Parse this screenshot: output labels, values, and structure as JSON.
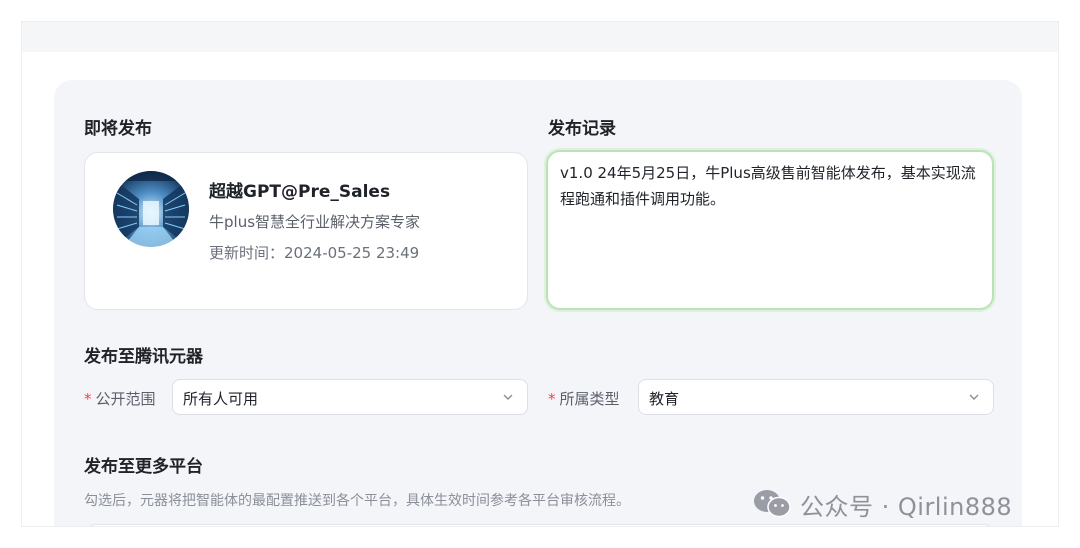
{
  "publish": {
    "section_title": "即将发布",
    "agent": {
      "name": "超越GPT@Pre_Sales",
      "description": "牛plus智慧全行业解决方案专家",
      "updated_label": "更新时间：",
      "updated_value": "2024-05-25 23:49"
    }
  },
  "release_record": {
    "section_title": "发布记录",
    "notes": "v1.0 24年5月25日，牛Plus高级售前智能体发布，基本实现流程跑通和插件调用功能。"
  },
  "tencent": {
    "section_title": "发布至腾讯元器",
    "visibility": {
      "required_mark": "*",
      "label": "公开范围",
      "value": "所有人可用"
    },
    "category": {
      "required_mark": "*",
      "label": "所属类型",
      "value": "教育"
    }
  },
  "more_platforms": {
    "section_title": "发布至更多平台",
    "hint": "勾选后，元器将把智能体的最配置推送到各个平台，具体生效时间参考各平台审核流程。"
  },
  "watermark": {
    "text": "公众号 · Qirlin888",
    "icon": "wechat-icon"
  },
  "colors": {
    "panel_bg": "#f4f5f9",
    "focus_border": "#b9e5b5",
    "required": "#e5484d"
  }
}
